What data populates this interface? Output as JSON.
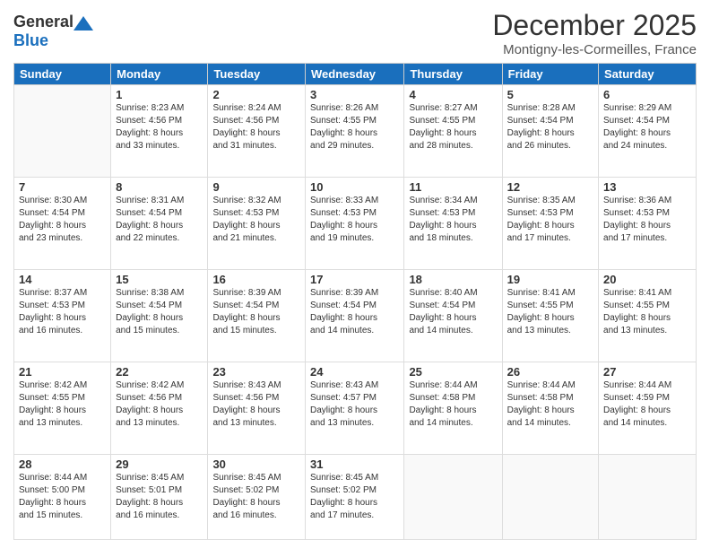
{
  "header": {
    "logo": {
      "general": "General",
      "blue": "Blue"
    },
    "title": "December 2025",
    "subtitle": "Montigny-les-Cormeilles, France"
  },
  "weekdays": [
    "Sunday",
    "Monday",
    "Tuesday",
    "Wednesday",
    "Thursday",
    "Friday",
    "Saturday"
  ],
  "weeks": [
    [
      {
        "day": "",
        "info": ""
      },
      {
        "day": "1",
        "info": "Sunrise: 8:23 AM\nSunset: 4:56 PM\nDaylight: 8 hours\nand 33 minutes."
      },
      {
        "day": "2",
        "info": "Sunrise: 8:24 AM\nSunset: 4:56 PM\nDaylight: 8 hours\nand 31 minutes."
      },
      {
        "day": "3",
        "info": "Sunrise: 8:26 AM\nSunset: 4:55 PM\nDaylight: 8 hours\nand 29 minutes."
      },
      {
        "day": "4",
        "info": "Sunrise: 8:27 AM\nSunset: 4:55 PM\nDaylight: 8 hours\nand 28 minutes."
      },
      {
        "day": "5",
        "info": "Sunrise: 8:28 AM\nSunset: 4:54 PM\nDaylight: 8 hours\nand 26 minutes."
      },
      {
        "day": "6",
        "info": "Sunrise: 8:29 AM\nSunset: 4:54 PM\nDaylight: 8 hours\nand 24 minutes."
      }
    ],
    [
      {
        "day": "7",
        "info": "Sunrise: 8:30 AM\nSunset: 4:54 PM\nDaylight: 8 hours\nand 23 minutes."
      },
      {
        "day": "8",
        "info": "Sunrise: 8:31 AM\nSunset: 4:54 PM\nDaylight: 8 hours\nand 22 minutes."
      },
      {
        "day": "9",
        "info": "Sunrise: 8:32 AM\nSunset: 4:53 PM\nDaylight: 8 hours\nand 21 minutes."
      },
      {
        "day": "10",
        "info": "Sunrise: 8:33 AM\nSunset: 4:53 PM\nDaylight: 8 hours\nand 19 minutes."
      },
      {
        "day": "11",
        "info": "Sunrise: 8:34 AM\nSunset: 4:53 PM\nDaylight: 8 hours\nand 18 minutes."
      },
      {
        "day": "12",
        "info": "Sunrise: 8:35 AM\nSunset: 4:53 PM\nDaylight: 8 hours\nand 17 minutes."
      },
      {
        "day": "13",
        "info": "Sunrise: 8:36 AM\nSunset: 4:53 PM\nDaylight: 8 hours\nand 17 minutes."
      }
    ],
    [
      {
        "day": "14",
        "info": "Sunrise: 8:37 AM\nSunset: 4:53 PM\nDaylight: 8 hours\nand 16 minutes."
      },
      {
        "day": "15",
        "info": "Sunrise: 8:38 AM\nSunset: 4:54 PM\nDaylight: 8 hours\nand 15 minutes."
      },
      {
        "day": "16",
        "info": "Sunrise: 8:39 AM\nSunset: 4:54 PM\nDaylight: 8 hours\nand 15 minutes."
      },
      {
        "day": "17",
        "info": "Sunrise: 8:39 AM\nSunset: 4:54 PM\nDaylight: 8 hours\nand 14 minutes."
      },
      {
        "day": "18",
        "info": "Sunrise: 8:40 AM\nSunset: 4:54 PM\nDaylight: 8 hours\nand 14 minutes."
      },
      {
        "day": "19",
        "info": "Sunrise: 8:41 AM\nSunset: 4:55 PM\nDaylight: 8 hours\nand 13 minutes."
      },
      {
        "day": "20",
        "info": "Sunrise: 8:41 AM\nSunset: 4:55 PM\nDaylight: 8 hours\nand 13 minutes."
      }
    ],
    [
      {
        "day": "21",
        "info": "Sunrise: 8:42 AM\nSunset: 4:55 PM\nDaylight: 8 hours\nand 13 minutes."
      },
      {
        "day": "22",
        "info": "Sunrise: 8:42 AM\nSunset: 4:56 PM\nDaylight: 8 hours\nand 13 minutes."
      },
      {
        "day": "23",
        "info": "Sunrise: 8:43 AM\nSunset: 4:56 PM\nDaylight: 8 hours\nand 13 minutes."
      },
      {
        "day": "24",
        "info": "Sunrise: 8:43 AM\nSunset: 4:57 PM\nDaylight: 8 hours\nand 13 minutes."
      },
      {
        "day": "25",
        "info": "Sunrise: 8:44 AM\nSunset: 4:58 PM\nDaylight: 8 hours\nand 14 minutes."
      },
      {
        "day": "26",
        "info": "Sunrise: 8:44 AM\nSunset: 4:58 PM\nDaylight: 8 hours\nand 14 minutes."
      },
      {
        "day": "27",
        "info": "Sunrise: 8:44 AM\nSunset: 4:59 PM\nDaylight: 8 hours\nand 14 minutes."
      }
    ],
    [
      {
        "day": "28",
        "info": "Sunrise: 8:44 AM\nSunset: 5:00 PM\nDaylight: 8 hours\nand 15 minutes."
      },
      {
        "day": "29",
        "info": "Sunrise: 8:45 AM\nSunset: 5:01 PM\nDaylight: 8 hours\nand 16 minutes."
      },
      {
        "day": "30",
        "info": "Sunrise: 8:45 AM\nSunset: 5:02 PM\nDaylight: 8 hours\nand 16 minutes."
      },
      {
        "day": "31",
        "info": "Sunrise: 8:45 AM\nSunset: 5:02 PM\nDaylight: 8 hours\nand 17 minutes."
      },
      {
        "day": "",
        "info": ""
      },
      {
        "day": "",
        "info": ""
      },
      {
        "day": "",
        "info": ""
      }
    ]
  ]
}
